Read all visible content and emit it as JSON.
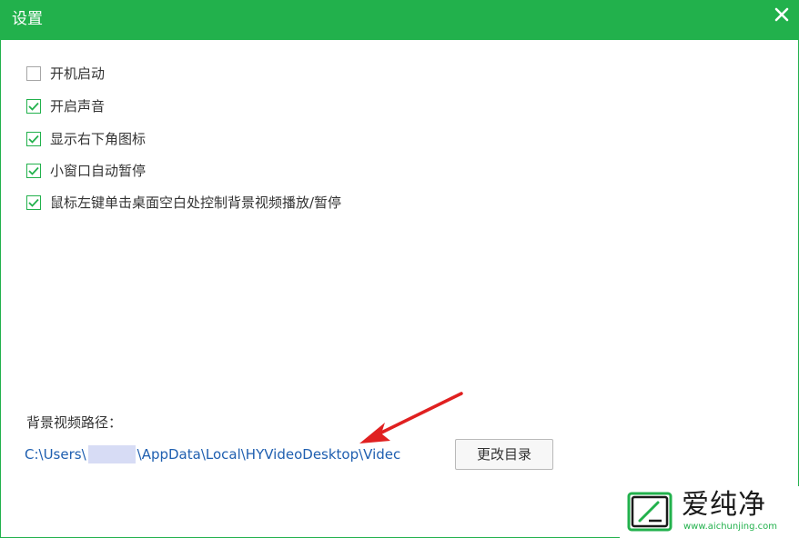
{
  "window": {
    "title": "设置",
    "accent": "#22b14c"
  },
  "options": [
    {
      "label": "开机启动",
      "checked": false
    },
    {
      "label": "开启声音",
      "checked": true
    },
    {
      "label": "显示右下角图标",
      "checked": true
    },
    {
      "label": "小窗口自动暂停",
      "checked": true
    },
    {
      "label": "鼠标左键单击桌面空白处控制背景视频播放/暂停",
      "checked": true
    }
  ],
  "path": {
    "label": "背景视频路径：",
    "prefix": "C:\\Users\\",
    "suffix": "\\AppData\\Local\\HYVideoDesktop\\Videc",
    "change_button": "更改目录",
    "link_color": "#1f5fb0"
  },
  "annotation": {
    "arrow_color": "#e02020"
  },
  "watermark": {
    "text": "爱纯净",
    "url": "www.aichunjing.com"
  }
}
